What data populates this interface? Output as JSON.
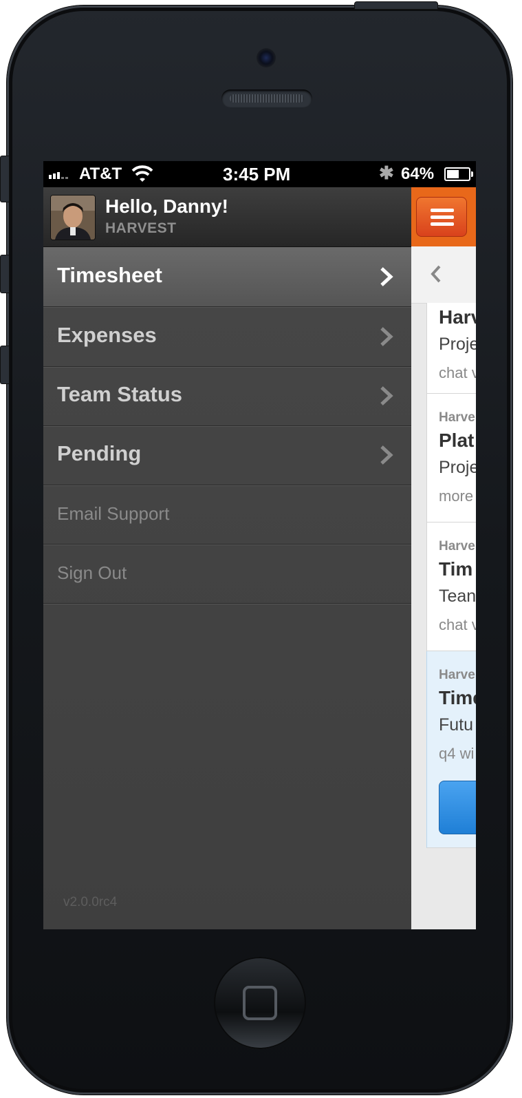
{
  "status_bar": {
    "carrier": "AT&T",
    "time": "3:45 PM",
    "battery_percent": "64%",
    "battery_level": 0.64,
    "signal_icon": "signal-bars-icon",
    "wifi_icon": "wifi-icon",
    "bluetooth_icon": "bluetooth-icon",
    "bluetooth_glyph": "✱"
  },
  "menu": {
    "greeting": "Hello, Danny!",
    "organization": "HARVEST",
    "items": [
      {
        "label": "Timesheet",
        "active": true
      },
      {
        "label": "Expenses"
      },
      {
        "label": "Team Status"
      },
      {
        "label": "Pending"
      },
      {
        "label": "Email Support"
      },
      {
        "label": "Sign Out"
      }
    ],
    "version": "v2.0.0rc4"
  },
  "content": {
    "cards": [
      {
        "title": "Harv",
        "subtitle": "Proje",
        "meta": "chat v"
      },
      {
        "source": "Harve",
        "title": "Plat",
        "subtitle": "Proje",
        "meta": "more"
      },
      {
        "source": "Harve",
        "title": "Tim",
        "subtitle": "Tean",
        "meta": "chat v"
      },
      {
        "source": "Harve",
        "title": "Time",
        "subtitle": "Futu",
        "meta": "q4 wi"
      }
    ]
  },
  "colors": {
    "accent_orange": "#e8681a",
    "menu_bg": "#474747",
    "highlight_blue": "#e4f1fb",
    "button_blue": "#1f7fd6"
  }
}
